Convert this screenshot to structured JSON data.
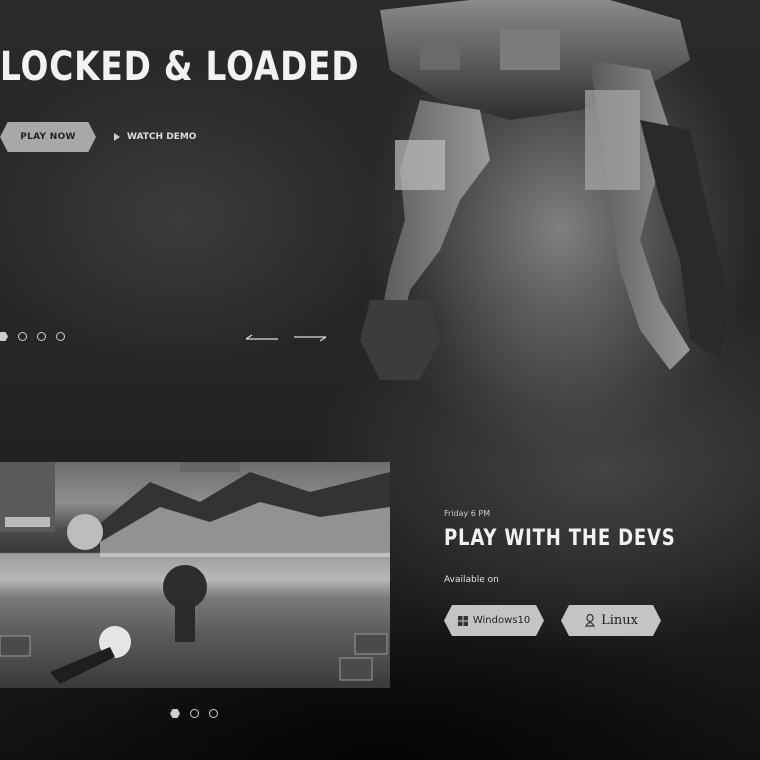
{
  "hero": {
    "title": "LOCKED & LOADED",
    "play_label": "PLAY NOW",
    "watch_label": "WATCH DEMO",
    "slides_total": 4,
    "active_slide": 1
  },
  "event": {
    "time": "Friday 6 PM",
    "title": "PLAY WITH THE DEVS",
    "available_label": "Available on",
    "platforms": [
      {
        "label": "Windows10",
        "icon": "windows-icon"
      },
      {
        "label": "Linux",
        "icon": "linux-icon"
      }
    ]
  },
  "gallery": {
    "slides_total": 3,
    "active_slide": 1
  },
  "colors": {
    "button_bg": "#a8a8a8",
    "text": "#f2f2f2"
  }
}
